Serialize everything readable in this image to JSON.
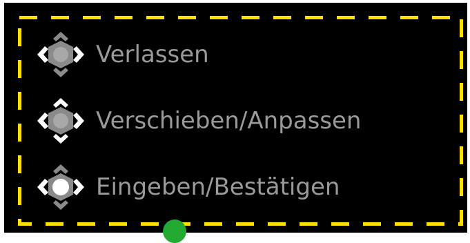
{
  "hints": [
    {
      "label": "Verlassen",
      "icon": "dpad-left-right-icon",
      "active_parts": [
        "left",
        "right"
      ]
    },
    {
      "label": "Verschieben/Anpassen",
      "icon": "dpad-all-directions-icon",
      "active_parts": [
        "up",
        "down",
        "left",
        "right"
      ]
    },
    {
      "label": "Eingeben/Bestätigen",
      "icon": "dpad-center-press-icon",
      "active_parts": [
        "center",
        "left",
        "right"
      ]
    }
  ],
  "colors": {
    "background": "#000000",
    "frame_dash": "#ffe000",
    "label": "#9a9a9a",
    "icon_active": "#ffffff",
    "icon_inactive": "#8a8a8a",
    "cursor": "#22aa33"
  }
}
